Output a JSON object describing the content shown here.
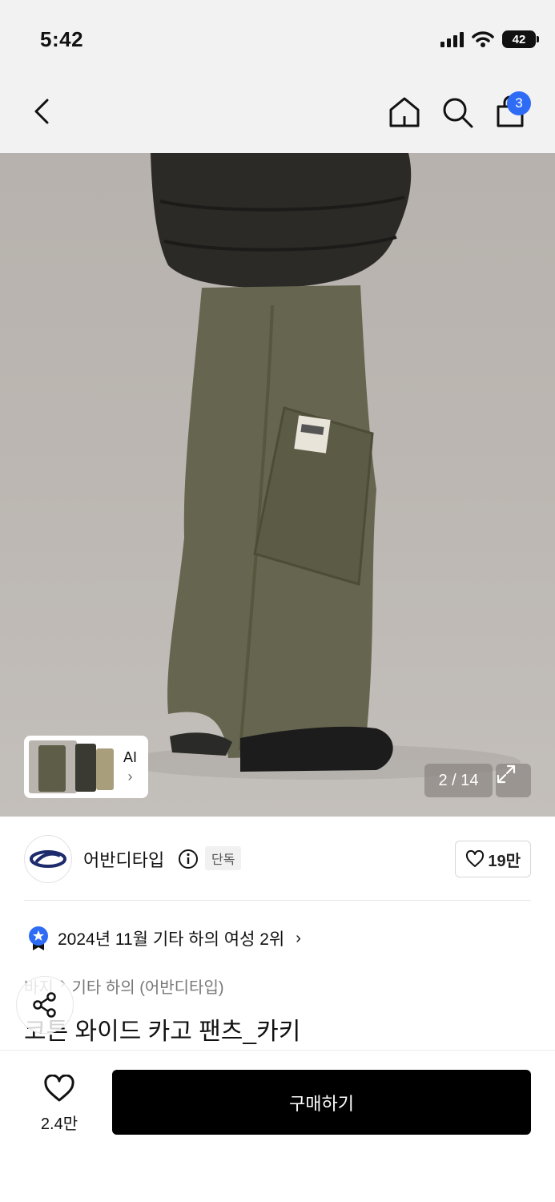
{
  "status_bar": {
    "time": "5:42",
    "battery": "42"
  },
  "nav": {
    "back_icon": "chevron-left-icon",
    "home_icon": "home-icon",
    "search_icon": "search-icon",
    "bag_icon": "shopping-bag-icon",
    "bag_count": "3"
  },
  "gallery": {
    "ai_label": "AI",
    "ai_chevron": "›",
    "counter": "2 / 14",
    "expand_icon": "expand-icon"
  },
  "brand": {
    "name": "어반디타입",
    "exclusive_badge": "단독",
    "like_count": "19만"
  },
  "ranking": {
    "text": "2024년 11월 기타 하의 여성 2위",
    "chevron": "›"
  },
  "breadcrumb": {
    "first": "바지",
    "separator": "›",
    "second": "기타 하의 (어반디타입)"
  },
  "product": {
    "title": "코튼 와이드 카고 팬츠_카키"
  },
  "bottom_bar": {
    "wish_count": "2.4만",
    "buy_label": "구매하기"
  },
  "colors": {
    "accent_blue": "#2f6cf6",
    "buy_button": "#000000",
    "brand_navy": "#1d2a6b"
  }
}
